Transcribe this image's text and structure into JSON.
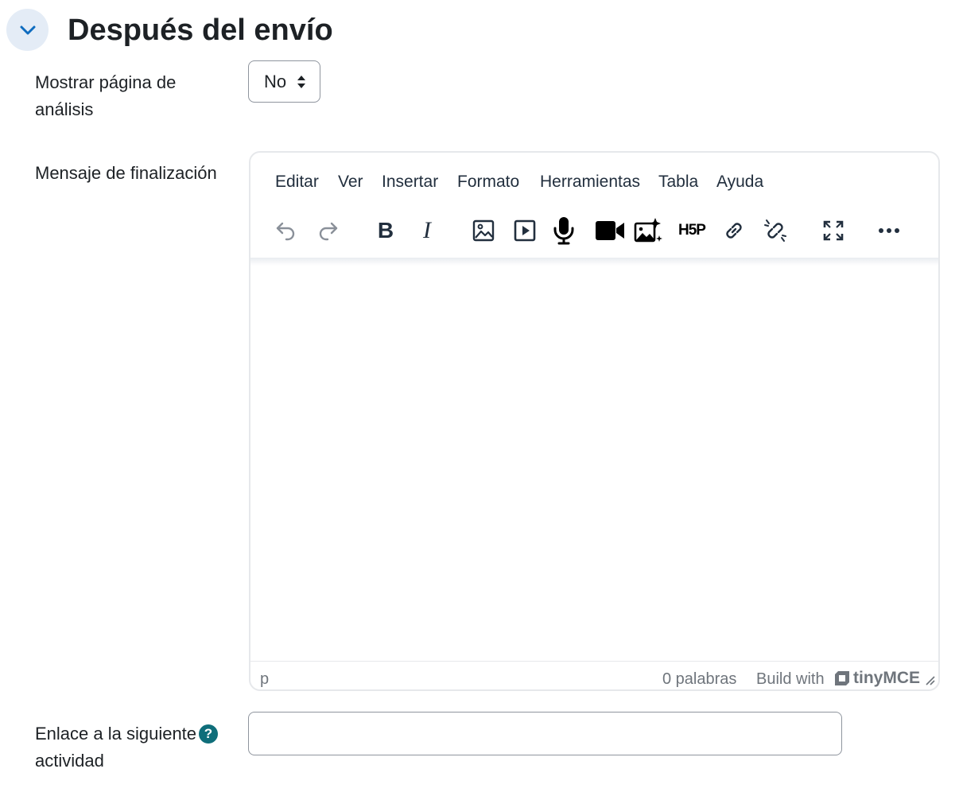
{
  "section": {
    "title": "Después del envío",
    "toggle_icon": "chevron-down-icon"
  },
  "fields": {
    "analysis_page": {
      "label": "Mostrar página de análisis",
      "value": "No"
    },
    "completion_message": {
      "label": "Mensaje de finalización"
    },
    "next_activity": {
      "label": "Enlace a la siguiente actividad",
      "value": "",
      "help_icon_text": "?"
    }
  },
  "editor": {
    "menu": [
      "Editar",
      "Ver",
      "Insertar",
      "Formato",
      "Herramientas",
      "Tabla",
      "Ayuda"
    ],
    "toolbar_icons": [
      "undo-icon",
      "redo-icon",
      "bold-icon",
      "italic-icon",
      "image-icon",
      "media-icon",
      "microphone-icon",
      "video-camera-icon",
      "ai-image-icon",
      "h5p-icon",
      "link-icon",
      "unlink-icon",
      "fullscreen-icon",
      "more-icon"
    ],
    "bold_glyph": "B",
    "italic_glyph": "I",
    "h5p_glyph": "H5P",
    "status": {
      "path": "p",
      "word_count": "0 palabras",
      "build_with": "Build with",
      "brand": "tinyMCE"
    }
  },
  "colors": {
    "accent": "#0f6cbf",
    "help": "#0f6e7a",
    "toggle_bg": "#e4ecf6"
  }
}
